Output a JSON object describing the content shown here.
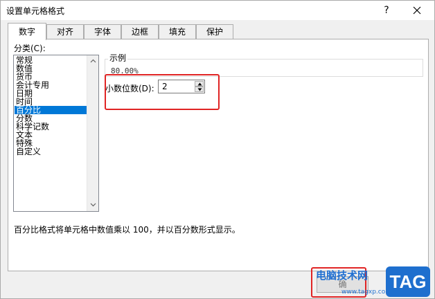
{
  "window": {
    "title": "设置单元格格式",
    "help_glyph": "?"
  },
  "tabs": [
    {
      "label": "数字",
      "active": true
    },
    {
      "label": "对齐",
      "active": false
    },
    {
      "label": "字体",
      "active": false
    },
    {
      "label": "边框",
      "active": false
    },
    {
      "label": "填充",
      "active": false
    },
    {
      "label": "保护",
      "active": false
    }
  ],
  "category": {
    "label": "分类(C):",
    "items": [
      "常规",
      "数值",
      "货币",
      "会计专用",
      "日期",
      "时间",
      "百分比",
      "分数",
      "科学记数",
      "文本",
      "特殊",
      "自定义"
    ],
    "selected": "百分比"
  },
  "sample": {
    "label": "示例",
    "value": "80.00%"
  },
  "decimal_places": {
    "label": "小数位数(D):",
    "value": "2"
  },
  "description": "百分比格式将单元格中数值乘以 100，并以百分数形式显示。",
  "ok_button_label": "确",
  "watermark": {
    "site": "电脑技术网",
    "url": "www.tagxp.com",
    "tag": "TAG"
  },
  "colors": {
    "selection": "#0078d7",
    "highlight": "#e02424",
    "watermark": "#1e6fce"
  }
}
